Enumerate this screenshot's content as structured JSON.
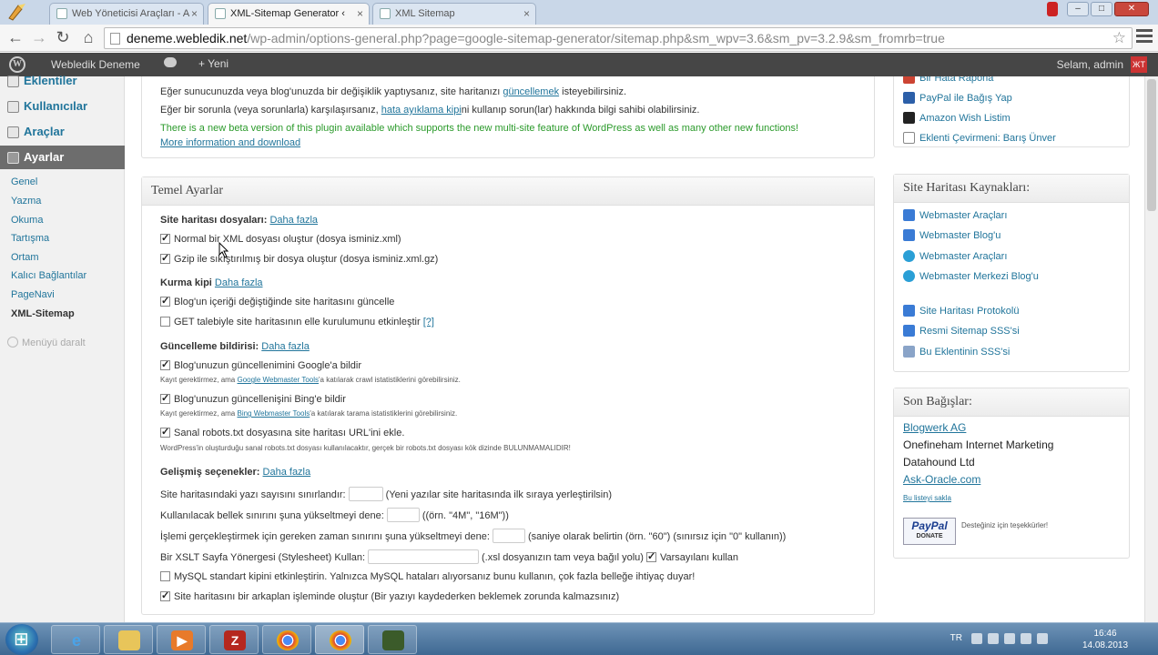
{
  "browser": {
    "tabs": [
      {
        "label": "Web Yöneticisi Araçları - A",
        "active": false
      },
      {
        "label": "XML-Sitemap Generator ‹",
        "active": true
      },
      {
        "label": "XML Sitemap",
        "active": false
      }
    ],
    "url_host": "deneme.webledik.net",
    "url_rest": "/wp-admin/options-general.php?page=google-sitemap-generator/sitemap.php&sm_wpv=3.6&sm_pv=3.2.9&sm_fromrb=true"
  },
  "adminbar": {
    "site_name": "Webledik Deneme",
    "new_label": "+ Yeni",
    "user_label": "Selam, admin"
  },
  "sidebar": {
    "menu": [
      {
        "label": "Eklentiler",
        "current": false
      },
      {
        "label": "Kullanıcılar",
        "current": false
      },
      {
        "label": "Araçlar",
        "current": false
      },
      {
        "label": "Ayarlar",
        "current": true
      }
    ],
    "submenu": [
      "Genel",
      "Yazma",
      "Okuma",
      "Tartışma",
      "Ortam",
      "Kalıcı Bağlantılar",
      "PageNavi",
      "XML-Sitemap"
    ],
    "collapse_label": "Menüyü daralt"
  },
  "notice": {
    "line1_pre": "Eğer sunucunuzda veya blog'unuzda bir değişiklik yaptıysanız, site haritanızı ",
    "line1_link": "güncellemek",
    "line1_post": " isteyebilirsiniz.",
    "line2_pre": "Eğer bir sorunla (veya sorunlarla) karşılaşırsanız, ",
    "line2_link": "hata ayıklama kipi",
    "line2_post": "ni kullanıp sorun(lar) hakkında bilgi sahibi olabilirsiniz.",
    "beta": "There is a new beta version of this plugin available which supports the new multi-site feature of WordPress as well as many other new functions!",
    "beta_link": "More information and download"
  },
  "basic": {
    "title": "Temel Ayarlar",
    "more": "Daha fazla",
    "files_heading": "Site haritası dosyaları:",
    "opt_xml": "Normal bir XML dosyası oluştur (dosya isminiz.xml)",
    "opt_gzip": "Gzip ile sıkıştırılmış bir dosya oluştur (dosya isminiz.xml.gz)",
    "build_heading": "Kurma kipi",
    "opt_rebuild": "Blog'un içeriği değiştiğinde site haritasını güncelle",
    "opt_get": "GET talebiyle site haritasının elle kurulumunu etkinleştir",
    "help": "[?]",
    "notify_heading": "Güncelleme bildirisi:",
    "opt_google": "Blog'unuzun güncellenimini Google'a bildir",
    "google_note_pre": "Kayıt gerektirmez, ama ",
    "google_note_link": "Google Webmaster Tools",
    "google_note_post": "'a katılarak crawl istatistiklerini görebilirsiniz.",
    "opt_bing": "Blog'unuzun güncellenişini Bing'e bildir",
    "bing_note_pre": "Kayıt gerektirmez, ama ",
    "bing_note_link": "Bing Webmaster Tools",
    "bing_note_post": "'a katılarak tarama istatistiklerini görebilirsiniz.",
    "opt_robots": "Sanal robots.txt dosyasına site haritası URL'ini ekle.",
    "robots_note": "WordPress'in oluşturduğu sanal robots.txt dosyası kullanılacaktır, gerçek bir robots.txt dosyası kök dizinde BULUNMAMALIDIR!",
    "adv_heading": "Gelişmiş seçenekler:",
    "adv_limit": "Site haritasındaki yazı sayısını sınırlandır:",
    "adv_limit_note": "(Yeni yazılar site haritasında ilk sıraya yerleştirilsin)",
    "adv_memory": "Kullanılacak bellek sınırını şuna yükseltmeyi dene:",
    "adv_memory_note": "((örn. \"4M\", \"16M\"))",
    "adv_time": "İşlemi gerçekleştirmek için gereken zaman sınırını şuna yükseltmeyi dene:",
    "adv_time_note": "(saniye olarak belirtin (örn. \"60\") (sınırsız için \"0\" kullanın))",
    "adv_xslt": "Bir XSLT Sayfa Yönergesi (Stylesheet) Kullan:",
    "adv_xslt_note": "(.xsl dosyanızın tam veya bağıl yolu)",
    "adv_xslt_default": "Varsayılanı kullan",
    "adv_mysql": "MySQL standart kipini etkinleştirin. Yalnızca MySQL hataları alıyorsanız bunu kullanın, çok fazla belleğe ihtiyaç duyar!",
    "adv_background": "Site haritasını bir arkaplan işleminde oluştur (Bir yazıyı kaydederken beklemek zorunda kalmazsınız)"
  },
  "about": {
    "links": [
      "Bir Hata Raporla",
      "PayPal ile Bağış Yap",
      "Amazon Wish Listim",
      "Eklenti Çevirmeni: Barış Ünver"
    ]
  },
  "resources": {
    "title": "Site Haritası Kaynakları:",
    "links": [
      "Webmaster Araçları",
      "Webmaster Blog'u",
      "Webmaster Araçları",
      "Webmaster Merkezi Blog'u",
      "Site Haritası Protokolü",
      "Resmi Sitemap SSS'si",
      "Bu Eklentinin SSS'si"
    ]
  },
  "donations": {
    "title": "Son Bağışlar:",
    "donors": [
      {
        "name": "Blogwerk AG",
        "link": true
      },
      {
        "name": "Onefineham Internet Marketing",
        "link": false
      },
      {
        "name": "Datahound Ltd",
        "link": false
      },
      {
        "name": "Ask-Oracle.com",
        "link": true
      }
    ],
    "hide_list": "Bu listeyi sakla",
    "paypal_top": "PayPal",
    "paypal_bottom": "DONATE",
    "thanks": "Desteğiniz için teşekkürler!"
  },
  "taskbar": {
    "lang": "TR",
    "time": "16:46",
    "date": "14.08.2013"
  },
  "colors": {
    "link": "#21759b",
    "beta_notice": "#2b9a2b",
    "adminbar": "#464646"
  }
}
